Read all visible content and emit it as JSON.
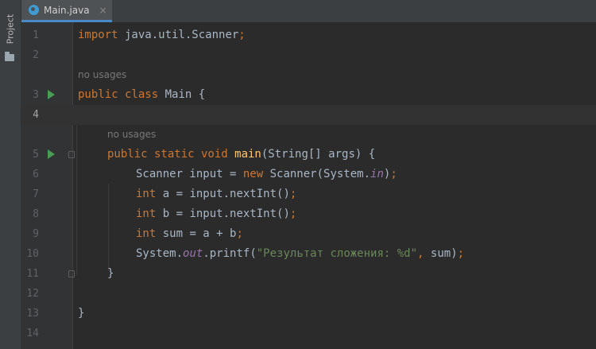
{
  "sidebar": {
    "project_label": "Project"
  },
  "tabs": [
    {
      "label": "Main.java",
      "close": "×"
    }
  ],
  "hints": {
    "no_usages": "no usages"
  },
  "line_numbers": [
    "1",
    "2",
    "3",
    "4",
    "5",
    "6",
    "7",
    "8",
    "9",
    "10",
    "11",
    "12",
    "13",
    "14"
  ],
  "code": {
    "l1_kw": "import",
    "l1_rest": " java.util.Scanner",
    "l1_semi": ";",
    "l3_kw": "public class",
    "l3_name": " Main",
    "l3_brace": " {",
    "l5_kw": "public static void",
    "l5_fn": " main",
    "l5_rest": "(String[] args) {",
    "l6_a": "Scanner input = ",
    "l6_kw": "new",
    "l6_b": " Scanner(System.",
    "l6_static": "in",
    "l6_c": ")",
    "l6_semi": ";",
    "l7_kw": "int",
    "l7_rest": " a = input.nextInt()",
    "l7_semi": ";",
    "l8_kw": "int",
    "l8_rest": " b = input.nextInt()",
    "l8_semi": ";",
    "l9_kw": "int",
    "l9_rest": " sum = a + b",
    "l9_semi": ";",
    "l10_a": "System.",
    "l10_static": "out",
    "l10_b": ".printf(",
    "l10_str": "\"Результат сложения: %d\"",
    "l10_comma": ",",
    "l10_c": " sum)",
    "l10_semi": ";",
    "l11": "}",
    "l13": "}"
  },
  "colors": {
    "keyword": "#cc7832",
    "method": "#ffc66d",
    "static_field": "#9876aa",
    "string": "#6a8759",
    "text": "#a9b7c6",
    "run_icon": "#499c54"
  },
  "icons": {
    "run": "run-icon",
    "file": "java-class-file-icon",
    "folder": "folder-icon"
  }
}
